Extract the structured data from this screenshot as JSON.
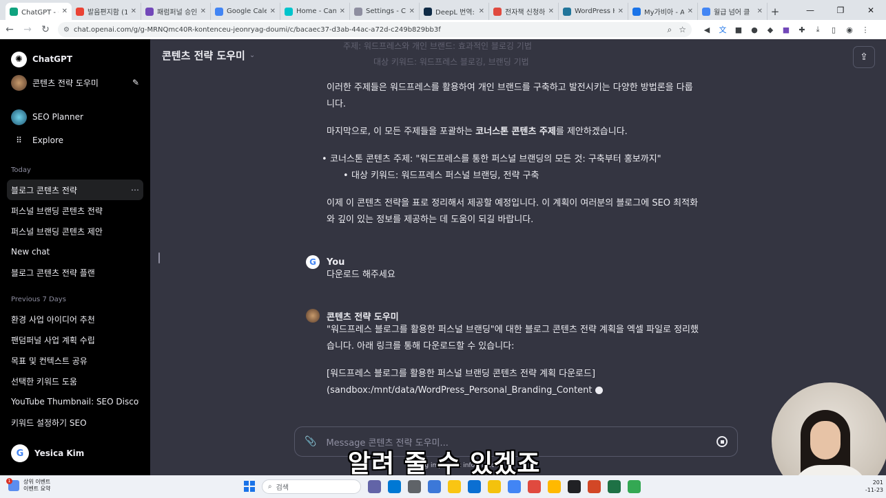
{
  "browser": {
    "tabs": [
      {
        "label": "ChatGPT - 콘텐",
        "color": "#10a37f",
        "active": true
      },
      {
        "label": "발음편지함 (1",
        "color": "#ea4335",
        "active": false
      },
      {
        "label": "패럼퍼널 승인",
        "color": "#7248b9",
        "active": false
      },
      {
        "label": "Google Calend",
        "color": "#4285f4",
        "active": false
      },
      {
        "label": "Home - Canva",
        "color": "#00c4cc",
        "active": false
      },
      {
        "label": "Settings - Can",
        "color": "#8e8ea0",
        "active": false
      },
      {
        "label": "DeepL 번역: A",
        "color": "#0f2b46",
        "active": false
      },
      {
        "label": "전자책 신청하",
        "color": "#e04a3f",
        "active": false
      },
      {
        "label": "WordPress Ho",
        "color": "#21759b",
        "active": false
      },
      {
        "label": "My가비아 - A",
        "color": "#1a73e8",
        "active": false
      },
      {
        "label": "월급 넘어 클",
        "color": "#4285f4",
        "active": false
      }
    ],
    "url": "chat.openai.com/g/g-MRNQmc40R-kontenceu-jeonryag-doumi/c/bacaec37-d3ab-44ac-a72d-c249b829bb3f"
  },
  "sidebar": {
    "app_name": "ChatGPT",
    "gpt_name": "콘텐츠 전략 도우미",
    "gpts": [
      "SEO Planner",
      "Explore"
    ],
    "today_label": "Today",
    "today": [
      {
        "label": "블로그 콘텐츠 전략",
        "active": true
      },
      {
        "label": "퍼스널 브랜딩 콘텐츠 전략",
        "active": false
      },
      {
        "label": "퍼스널 브랜딩 콘텐츠 제안",
        "active": false
      },
      {
        "label": "New chat",
        "active": false
      },
      {
        "label": "블로그 콘텐츠 전략 플랜",
        "active": false
      }
    ],
    "prev_label": "Previous 7 Days",
    "previous": [
      "환경 사업 아이디어 추천",
      "팬덤퍼널 사업 계획 수립",
      "목표 및 컨텍스트 공유",
      "선택한 키워드 도움",
      "YouTube Thumbnail: SEO Discove",
      "키워드 설정하기 SEO"
    ],
    "user_name": "Yesica Kim",
    "more_icon": "⋯"
  },
  "main": {
    "title": "콘텐츠 전략 도우미",
    "faded_line_1": "주제: 워드프레스와 개인 브랜드: 효과적인 블로깅 기법",
    "faded_line_2": "대상 키워드: 워드프레스 블로깅, 브랜딩 기법",
    "para1_line1": "이러한 주제들은 워드프레스를 활용하여 개인 브랜드를 구축하고 발전시키는 다양한 방법론을 다룹",
    "para1_line2": "니다.",
    "para2_pre": "마지막으로, 이 모든 주제들을 포괄하는 ",
    "para2_bold": "코너스톤 콘텐츠 주제",
    "para2_post": "를 제안하겠습니다.",
    "bullet1": "코너스톤 콘텐츠 주제: \"워드프레스를 통한 퍼스널 브랜딩의 모든 것: 구축부터 홍보까지\"",
    "bullet2": "대상 키워드: 워드프레스 퍼스널 브랜딩, 전략 구축",
    "para3_line1": "이제 이 콘텐츠 전략을 표로 정리해서 제공할 예정입니다. 이 계획이 여러분의 블로그에 SEO 최적화",
    "para3_line2": "와 깊이 있는 정보를 제공하는 데 도움이 되길 바랍니다.",
    "user_name": "You",
    "user_msg": "다운로드 해주세요",
    "bot_name": "콘텐츠 전략 도우미",
    "bot_line1": "\"워드프레스 블로그를 활용한 퍼스널 브랜딩\"에 대한 블로그 콘텐츠 전략 계획을 엑셀 파일로 정리했",
    "bot_line2": "습니다. 아래 링크를 통해 다운로드할 수 있습니다:",
    "bot_line3": "[워드프레스 블로그를 활용한 퍼스널 브랜딩 콘텐츠 전략 계획 다운로드]",
    "bot_line4": "(sandbox:/mnt/data/WordPress_Personal_Branding_Content",
    "placeholder": "Message 콘텐츠 전략 도우미...",
    "disclaimer": "cking important information."
  },
  "overlay": {
    "subtitle": "알려 줄 수 있겠죠"
  },
  "taskbar": {
    "news_title": "상위 이벤트",
    "news_sub": "이벤트 요약",
    "news_badge": "1",
    "search_label": "검색",
    "clock_line1": "201",
    "clock_line2": "-11-23",
    "app_colors": [
      "#6264a7",
      "#0078d4",
      "#5f6368",
      "#3c78d8",
      "#f9c513",
      "#0b6fd2",
      "#f4c20d",
      "#4285f4",
      "#e04a3f",
      "#ffb900",
      "#202124",
      "#d24726",
      "#1e7145",
      "#34a853"
    ]
  }
}
